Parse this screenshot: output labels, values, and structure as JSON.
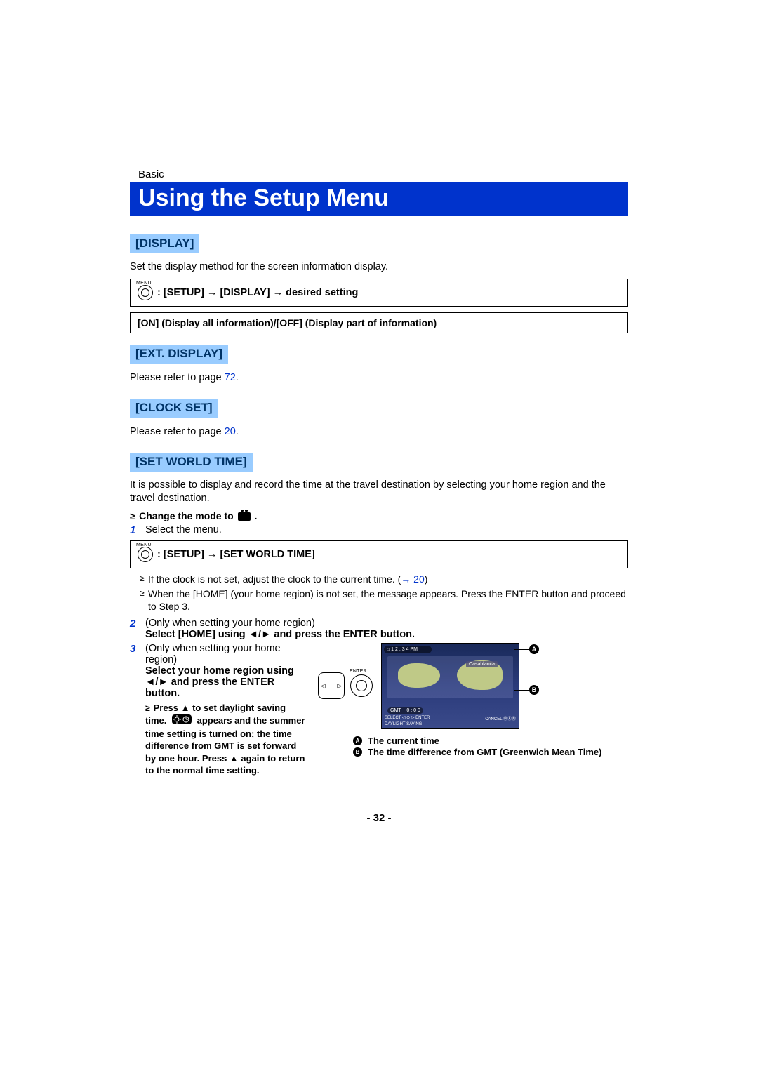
{
  "breadcrumb": "Basic",
  "title": "Using the Setup Menu",
  "sections": {
    "display": {
      "head": "[DISPLAY]",
      "desc": "Set the display method for the screen information display.",
      "box": ": [SETUP] → [DISPLAY] → desired setting",
      "sub": "[ON] (Display all information)/[OFF] (Display part of information)"
    },
    "ext_display": {
      "head": "[EXT. DISPLAY]",
      "refer_pre": "Please refer to page ",
      "refer_link": "72",
      "refer_post": "."
    },
    "clock_set": {
      "head": "[CLOCK SET]",
      "refer_pre": "Please refer to page ",
      "refer_link": "20",
      "refer_post": "."
    },
    "world_time": {
      "head": "[SET WORLD TIME]",
      "desc": "It is possible to display and record the time at the travel destination by selecting your home region and the travel destination.",
      "change_mode": "Change the mode to ",
      "change_mode_post": " .",
      "step1": {
        "num": "1",
        "label": "Select the menu.",
        "box": ": [SETUP] → [SET WORLD TIME]"
      },
      "notes": [
        {
          "pre": "If the clock is not set, adjust the clock to the current time. (",
          "link": "→ 20",
          "post": ")"
        },
        {
          "text": "When the [HOME] (your home region) is not set, the message appears. Press the ENTER button and proceed to Step 3."
        }
      ],
      "step2": {
        "num": "2",
        "line1": "(Only when setting your home region)",
        "line2": "Select [HOME] using ◄/► and press the ENTER button."
      },
      "step3": {
        "num": "3",
        "line1": "(Only when setting your home region)",
        "line2": "Select your home region using ◄/► and press the ENTER button.",
        "sub1": "Press ▲ to set daylight saving time.",
        "sub2": " appears and the summer time setting is turned on; the time difference from GMT is set forward by one hour. Press ▲ again to return to the normal time setting."
      },
      "screen": {
        "time": "⌂ 1 2 : 3 4 PM",
        "city": "Casablanca",
        "gmt": "GMT   +  0 : 0 0",
        "ds": "DAYLIGHT SAVING",
        "select": "SELECT ◁ ⊙ ▷ ENTER",
        "cancel": "CANCEL ⓂⒺⓃ"
      },
      "legend": {
        "a": "The current time",
        "b": "The time difference from GMT (Greenwich Mean Time)"
      }
    }
  },
  "page_number": "- 32 -"
}
